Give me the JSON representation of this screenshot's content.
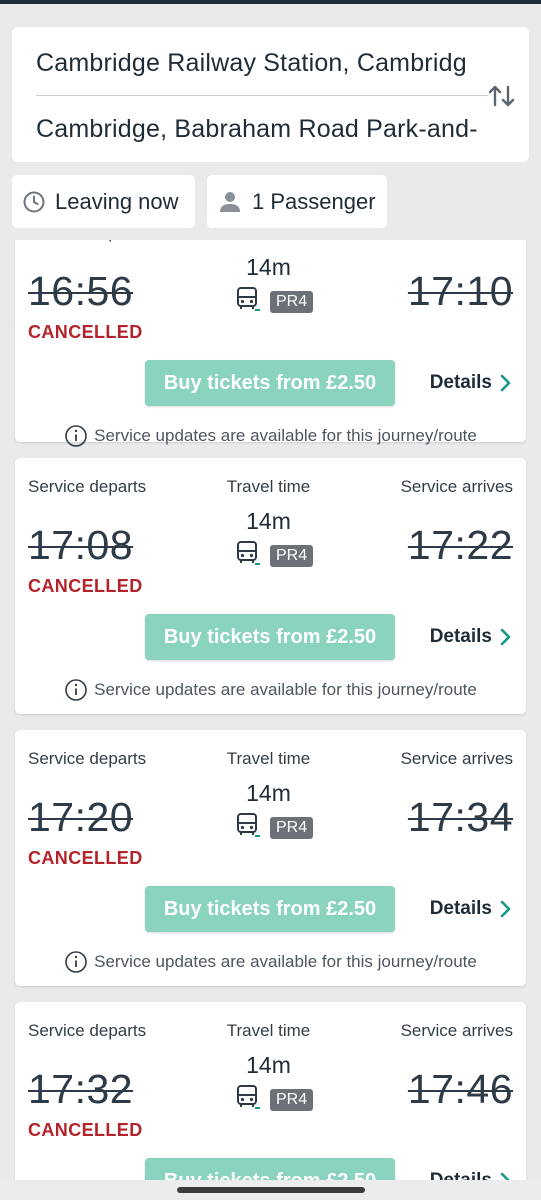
{
  "route": {
    "from": "Cambridge Railway Station, Cambridg",
    "to": "Cambridge, Babraham Road Park-and-"
  },
  "filters": {
    "time_label": "Leaving now",
    "passengers_label": "1 Passenger"
  },
  "labels": {
    "departs": "Service departs",
    "travel_time": "Travel time",
    "arrives": "Service arrives",
    "buy": "Buy tickets from £2.50",
    "details": "Details",
    "notice": "Service updates are available for this journey/route"
  },
  "journeys": [
    {
      "depart": "16:56",
      "arrive": "17:10",
      "duration": "14m",
      "route": "PR4",
      "status": "CANCELLED"
    },
    {
      "depart": "17:08",
      "arrive": "17:22",
      "duration": "14m",
      "route": "PR4",
      "status": "CANCELLED"
    },
    {
      "depart": "17:20",
      "arrive": "17:34",
      "duration": "14m",
      "route": "PR4",
      "status": "CANCELLED"
    },
    {
      "depart": "17:32",
      "arrive": "17:46",
      "duration": "14m",
      "route": "PR4",
      "status": "CANCELLED"
    }
  ],
  "colors": {
    "accent": "#8ad3bf",
    "cancelled": "#b3232b",
    "chevron": "#1a9a82"
  },
  "icons": [
    "swap-icon",
    "clock-icon",
    "person-icon",
    "bus-icon",
    "chevron-right-icon",
    "info-icon"
  ]
}
